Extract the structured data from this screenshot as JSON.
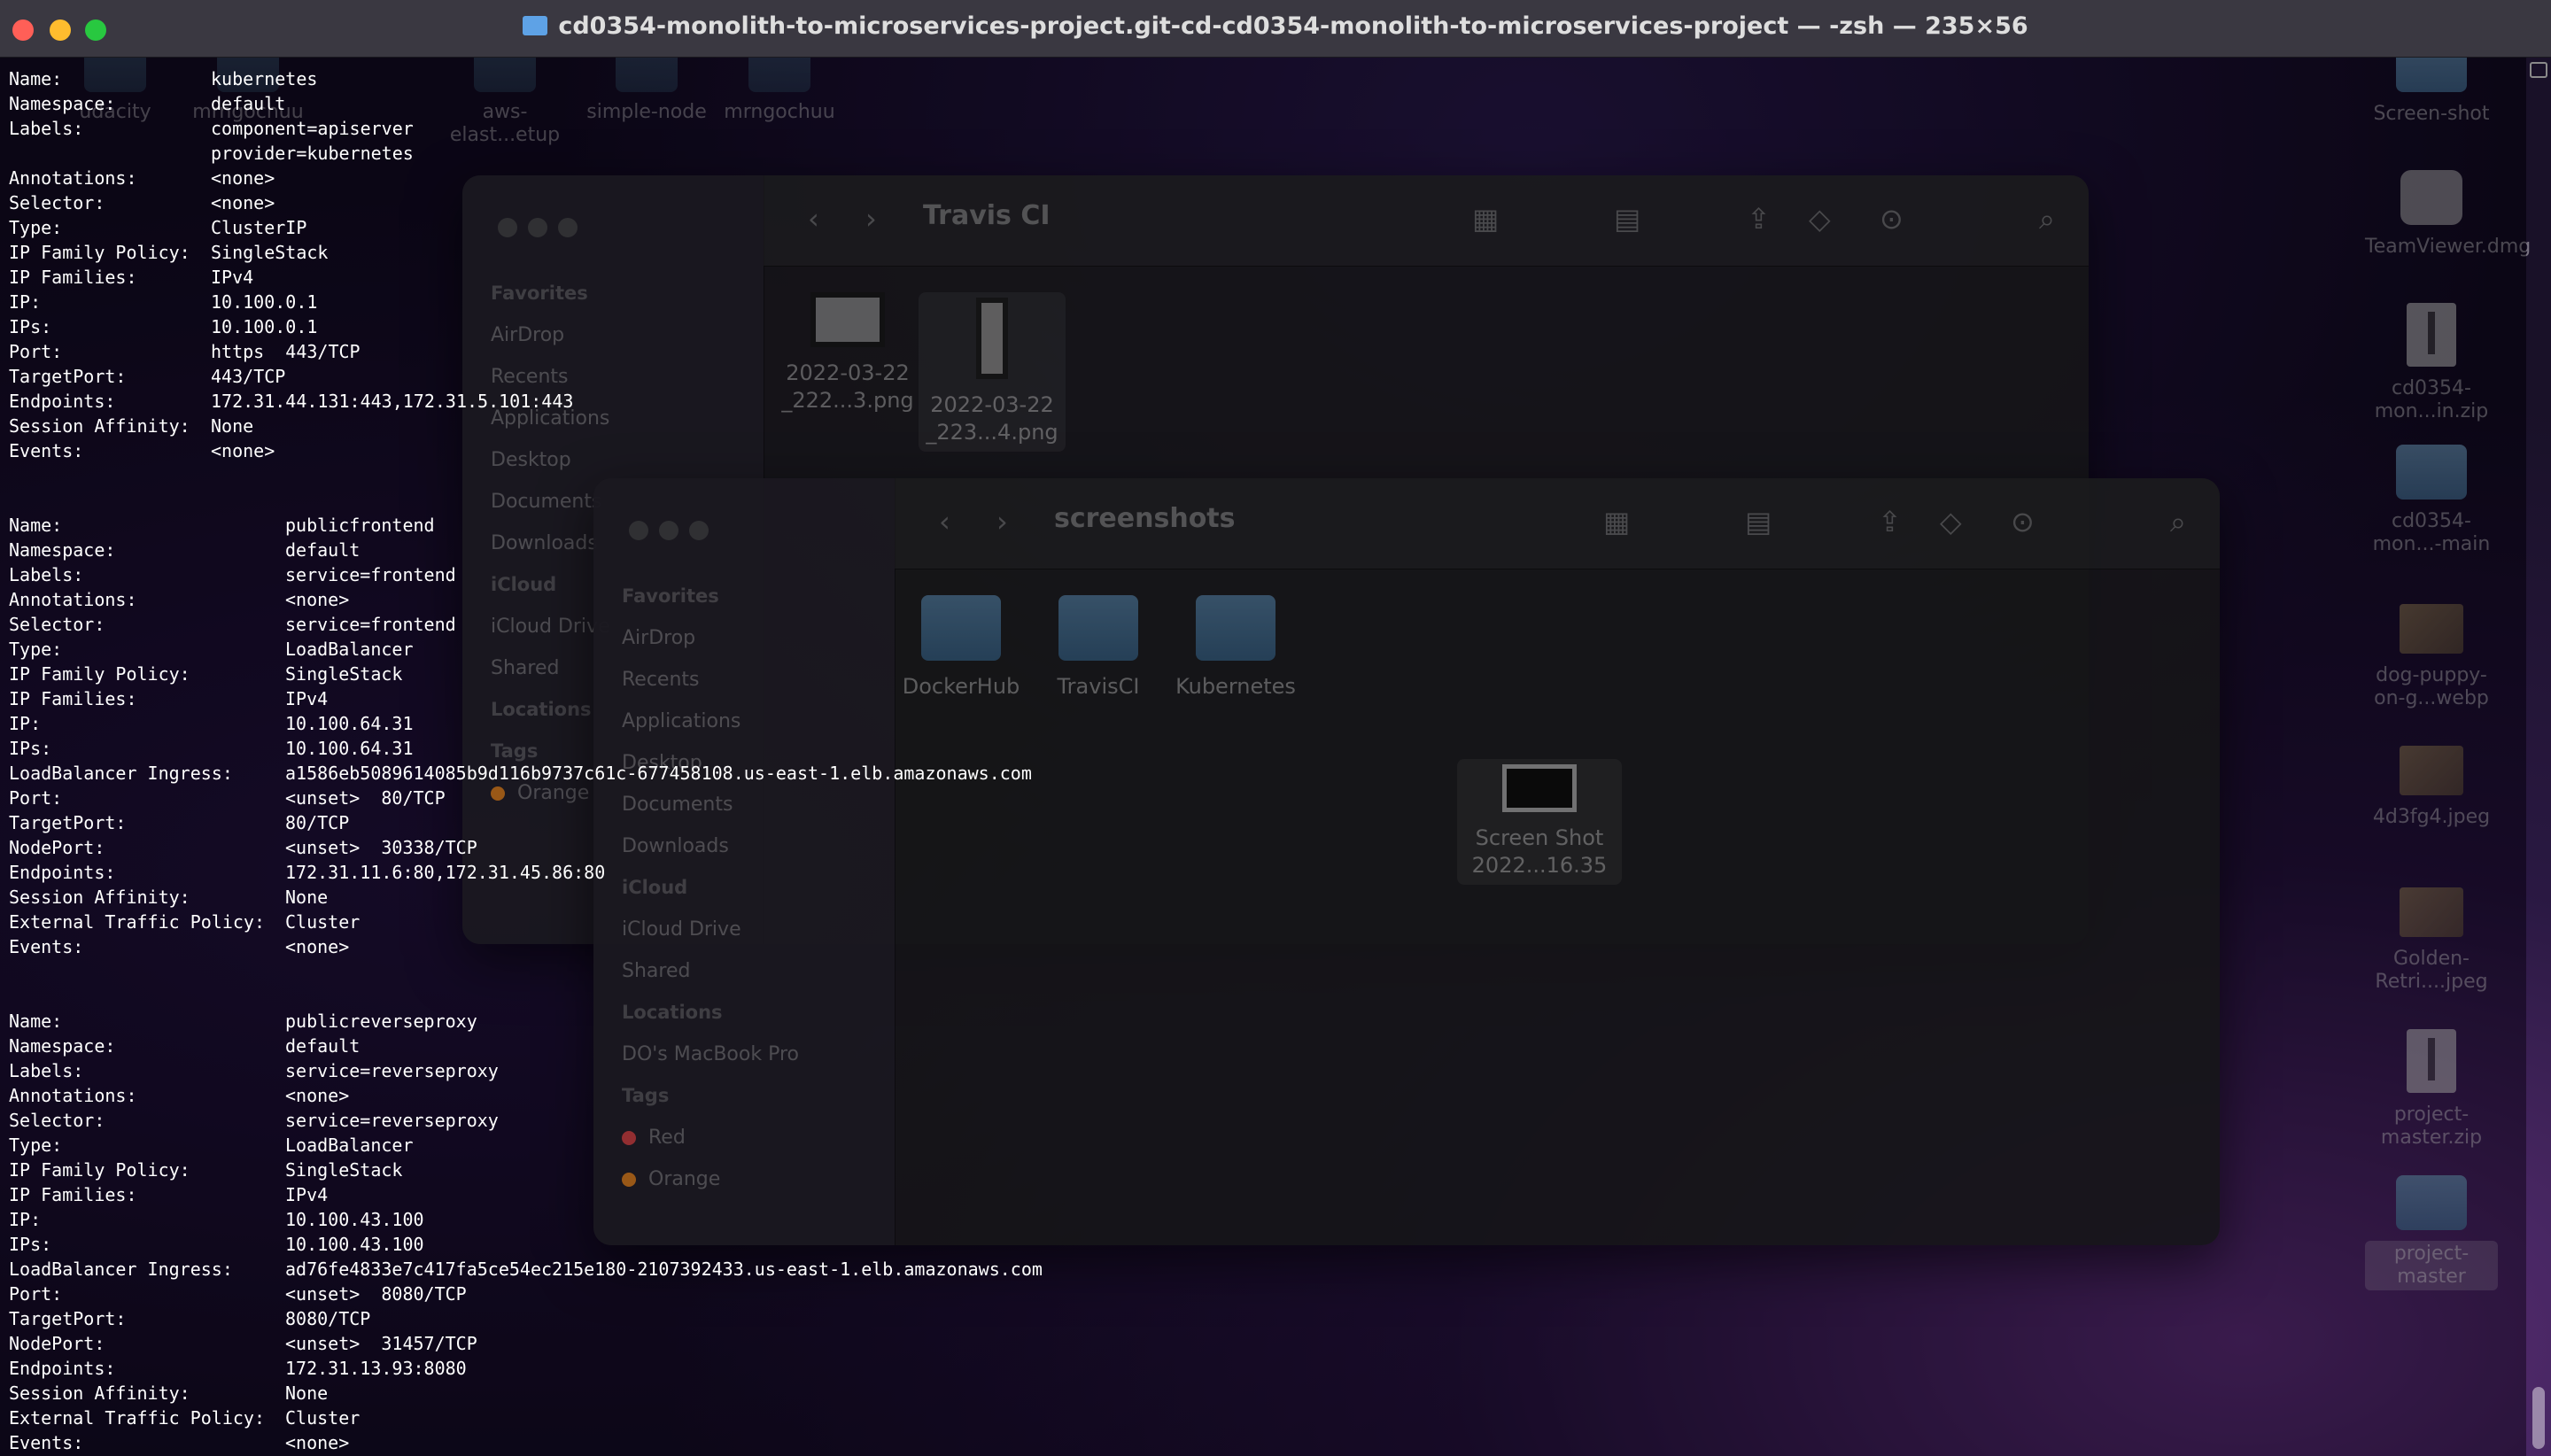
{
  "window": {
    "title": "cd0354-monolith-to-microservices-project.git-cd-cd0354-monolith-to-microservices-project — -zsh — 235×56"
  },
  "desktop": {
    "top_items": [
      "udacity",
      "mrngochuu",
      "aws-elast...etup",
      "simple-node",
      "mrngochuu"
    ],
    "right_items": [
      {
        "label": "Screen-shot",
        "icon": "folder-icon"
      },
      {
        "label": "TeamViewer.dmg",
        "icon": "disk-image-icon"
      },
      {
        "label": "cd0354-mon...in.zip",
        "icon": "zip-file-icon"
      },
      {
        "label": "cd0354-mon...-main",
        "icon": "folder-icon"
      },
      {
        "label": "dog-puppy-on-g...webp",
        "icon": "image-file-icon"
      },
      {
        "label": "4d3fg4.jpeg",
        "icon": "image-file-icon"
      },
      {
        "label": "Golden-Retri....jpeg",
        "icon": "image-file-icon"
      },
      {
        "label": "project-master.zip",
        "icon": "zip-file-icon"
      },
      {
        "label": "project-master",
        "icon": "folder-icon"
      }
    ]
  },
  "finder_back": {
    "title": "Travis CI",
    "sidebar": [
      {
        "type": "head",
        "label": "Favorites"
      },
      {
        "type": "item",
        "label": "AirDrop"
      },
      {
        "type": "item",
        "label": "Recents"
      },
      {
        "type": "item",
        "label": "Applications"
      },
      {
        "type": "item",
        "label": "Desktop"
      },
      {
        "type": "item",
        "label": "Documents"
      },
      {
        "type": "item",
        "label": "Downloads"
      },
      {
        "type": "head",
        "label": "iCloud"
      },
      {
        "type": "item",
        "label": "iCloud Drive"
      },
      {
        "type": "item",
        "label": "Shared"
      },
      {
        "type": "head",
        "label": "Locations"
      },
      {
        "type": "item",
        "label": ""
      },
      {
        "type": "head",
        "label": "Tags"
      },
      {
        "type": "item",
        "label": "Orange",
        "color": "#f08a24"
      }
    ],
    "files": [
      "2022-03-22 _222...3.png",
      "2022-03-22 _223...4.png"
    ]
  },
  "finder_front": {
    "title": "screenshots",
    "sidebar": [
      {
        "type": "head",
        "label": "Favorites"
      },
      {
        "type": "item",
        "label": "AirDrop"
      },
      {
        "type": "item",
        "label": "Recents"
      },
      {
        "type": "item",
        "label": "Applications"
      },
      {
        "type": "item",
        "label": "Desktop"
      },
      {
        "type": "item",
        "label": "Documents"
      },
      {
        "type": "item",
        "label": "Downloads"
      },
      {
        "type": "head",
        "label": "iCloud"
      },
      {
        "type": "item",
        "label": "iCloud Drive"
      },
      {
        "type": "item",
        "label": "Shared"
      },
      {
        "type": "head",
        "label": "Locations"
      },
      {
        "type": "item",
        "label": "DO's MacBook Pro"
      },
      {
        "type": "head",
        "label": "Tags"
      },
      {
        "type": "item",
        "label": "Red",
        "color": "#e5484d"
      },
      {
        "type": "item",
        "label": "Orange",
        "color": "#f08a24"
      }
    ],
    "folders": [
      "DockerHub",
      "TravisCI",
      "Kubernetes"
    ],
    "files": [
      "Screen Shot 2022...16.35"
    ]
  },
  "terminal": {
    "lines": [
      {
        "k": "Name:",
        "v": "kubernetes",
        "col": 1
      },
      {
        "k": "Namespace:",
        "v": "default",
        "col": 1
      },
      {
        "k": "Labels:",
        "v": "component=apiserver",
        "col": 1
      },
      {
        "k": "",
        "v": "provider=kubernetes",
        "col": 1
      },
      {
        "k": "Annotations:",
        "v": "<none>",
        "col": 1
      },
      {
        "k": "Selector:",
        "v": "<none>",
        "col": 1
      },
      {
        "k": "Type:",
        "v": "ClusterIP",
        "col": 1
      },
      {
        "k": "IP Family Policy:",
        "v": "SingleStack",
        "col": 1
      },
      {
        "k": "IP Families:",
        "v": "IPv4",
        "col": 1
      },
      {
        "k": "IP:",
        "v": "10.100.0.1",
        "col": 1
      },
      {
        "k": "IPs:",
        "v": "10.100.0.1",
        "col": 1
      },
      {
        "k": "Port:",
        "v": "https  443/TCP",
        "col": 1
      },
      {
        "k": "TargetPort:",
        "v": "443/TCP",
        "col": 1
      },
      {
        "k": "Endpoints:",
        "v": "172.31.44.131:443,172.31.5.101:443",
        "col": 1
      },
      {
        "k": "Session Affinity:",
        "v": "None",
        "col": 1
      },
      {
        "k": "Events:",
        "v": "<none>",
        "col": 1
      },
      {
        "k": "",
        "v": "",
        "col": 1
      },
      {
        "k": "",
        "v": "",
        "col": 1
      },
      {
        "k": "Name:",
        "v": "publicfrontend",
        "col": 2
      },
      {
        "k": "Namespace:",
        "v": "default",
        "col": 2
      },
      {
        "k": "Labels:",
        "v": "service=frontend",
        "col": 2
      },
      {
        "k": "Annotations:",
        "v": "<none>",
        "col": 2
      },
      {
        "k": "Selector:",
        "v": "service=frontend",
        "col": 2
      },
      {
        "k": "Type:",
        "v": "LoadBalancer",
        "col": 2
      },
      {
        "k": "IP Family Policy:",
        "v": "SingleStack",
        "col": 2
      },
      {
        "k": "IP Families:",
        "v": "IPv4",
        "col": 2
      },
      {
        "k": "IP:",
        "v": "10.100.64.31",
        "col": 2
      },
      {
        "k": "IPs:",
        "v": "10.100.64.31",
        "col": 2
      },
      {
        "k": "LoadBalancer Ingress:",
        "v": "a1586eb5089614085b9d116b9737c61c-677458108.us-east-1.elb.amazonaws.com",
        "col": 2
      },
      {
        "k": "Port:",
        "v": "<unset>  80/TCP",
        "col": 2
      },
      {
        "k": "TargetPort:",
        "v": "80/TCP",
        "col": 2
      },
      {
        "k": "NodePort:",
        "v": "<unset>  30338/TCP",
        "col": 2
      },
      {
        "k": "Endpoints:",
        "v": "172.31.11.6:80,172.31.45.86:80",
        "col": 2
      },
      {
        "k": "Session Affinity:",
        "v": "None",
        "col": 2
      },
      {
        "k": "External Traffic Policy:",
        "v": "Cluster",
        "col": 2
      },
      {
        "k": "Events:",
        "v": "<none>",
        "col": 2
      },
      {
        "k": "",
        "v": "",
        "col": 2
      },
      {
        "k": "",
        "v": "",
        "col": 2
      },
      {
        "k": "Name:",
        "v": "publicreverseproxy",
        "col": 2
      },
      {
        "k": "Namespace:",
        "v": "default",
        "col": 2
      },
      {
        "k": "Labels:",
        "v": "service=reverseproxy",
        "col": 2
      },
      {
        "k": "Annotations:",
        "v": "<none>",
        "col": 2
      },
      {
        "k": "Selector:",
        "v": "service=reverseproxy",
        "col": 2
      },
      {
        "k": "Type:",
        "v": "LoadBalancer",
        "col": 2
      },
      {
        "k": "IP Family Policy:",
        "v": "SingleStack",
        "col": 2
      },
      {
        "k": "IP Families:",
        "v": "IPv4",
        "col": 2
      },
      {
        "k": "IP:",
        "v": "10.100.43.100",
        "col": 2
      },
      {
        "k": "IPs:",
        "v": "10.100.43.100",
        "col": 2
      },
      {
        "k": "LoadBalancer Ingress:",
        "v": "ad76fe4833e7c417fa5ce54ec215e180-2107392433.us-east-1.elb.amazonaws.com",
        "col": 2
      },
      {
        "k": "Port:",
        "v": "<unset>  8080/TCP",
        "col": 2
      },
      {
        "k": "TargetPort:",
        "v": "8080/TCP",
        "col": 2
      },
      {
        "k": "NodePort:",
        "v": "<unset>  31457/TCP",
        "col": 2
      },
      {
        "k": "Endpoints:",
        "v": "172.31.13.93:8080",
        "col": 2
      },
      {
        "k": "Session Affinity:",
        "v": "None",
        "col": 2
      },
      {
        "k": "External Traffic Policy:",
        "v": "Cluster",
        "col": 2
      },
      {
        "k": "Events:",
        "v": "<none>",
        "col": 2
      }
    ]
  },
  "colors": {
    "close": "#ff5f57",
    "minimize": "#febc2e",
    "zoom": "#28c840"
  }
}
